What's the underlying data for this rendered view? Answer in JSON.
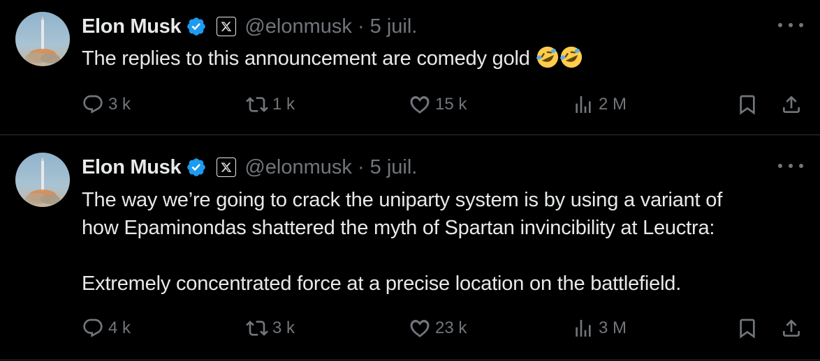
{
  "tweets": [
    {
      "name": "Elon Musk",
      "handle": "@elonmusk · 5 juil.",
      "text_lines": [
        "The replies to this announcement are comedy gold"
      ],
      "emoji": [
        "rolling-on-floor-laughing",
        "rolling-on-floor-laughing"
      ],
      "stats": {
        "replies": "3 k",
        "reposts": "1 k",
        "likes": "15 k",
        "views": "2 M"
      }
    },
    {
      "name": "Elon Musk",
      "handle": "@elonmusk · 5 juil.",
      "text_lines": [
        "The way we’re going to crack the uniparty system is by using a variant of",
        "how Epaminondas shattered the myth of Spartan invincibility at Leuctra:",
        "",
        "Extremely concentrated force at a precise location on the battlefield."
      ],
      "stats": {
        "replies": "4 k",
        "reposts": "3 k",
        "likes": "23 k",
        "views": "3 M"
      }
    }
  ],
  "colors": {
    "background": "#000000",
    "text": "#e7e9ea",
    "muted": "#71767b",
    "verified": "#1d9bf0",
    "divider": "#2f3336"
  }
}
